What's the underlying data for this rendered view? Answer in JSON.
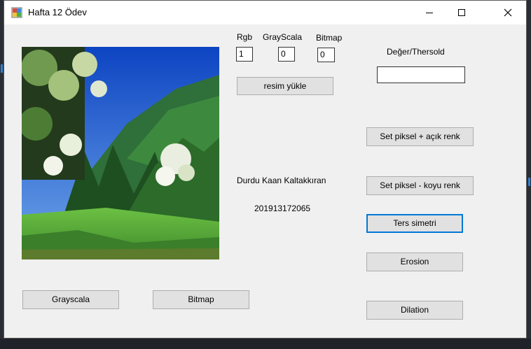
{
  "window": {
    "title": "Hafta 12 Ödev",
    "controls": [
      "minimize-icon",
      "maximize-icon",
      "close-icon"
    ]
  },
  "inputs": {
    "rgb": {
      "label": "Rgb",
      "value": "1"
    },
    "grayscale": {
      "label": "GrayScala",
      "value": "0"
    },
    "bitmap": {
      "label": "Bitmap",
      "value": "0"
    },
    "threshold": {
      "label": "Değer/Thersold",
      "value": ""
    }
  },
  "buttons": {
    "load_image": "resim yükle",
    "set_pixel_light": "Set piksel + açık renk",
    "set_pixel_dark": "Set piksel - koyu renk",
    "reverse_symmetry": "Ters simetri",
    "erosion": "Erosion",
    "dilation": "Dilation",
    "grayscale": "Grayscala",
    "bitmap": "Bitmap"
  },
  "author": {
    "name": "Durdu Kaan Kaltakkıran",
    "student_id": "201913172065"
  },
  "picture": {
    "description_icon": "landscape-photo",
    "colors": {
      "sky": "#1a5fd0",
      "grass": "#4fa83a",
      "forest": "#1f5a22"
    }
  }
}
